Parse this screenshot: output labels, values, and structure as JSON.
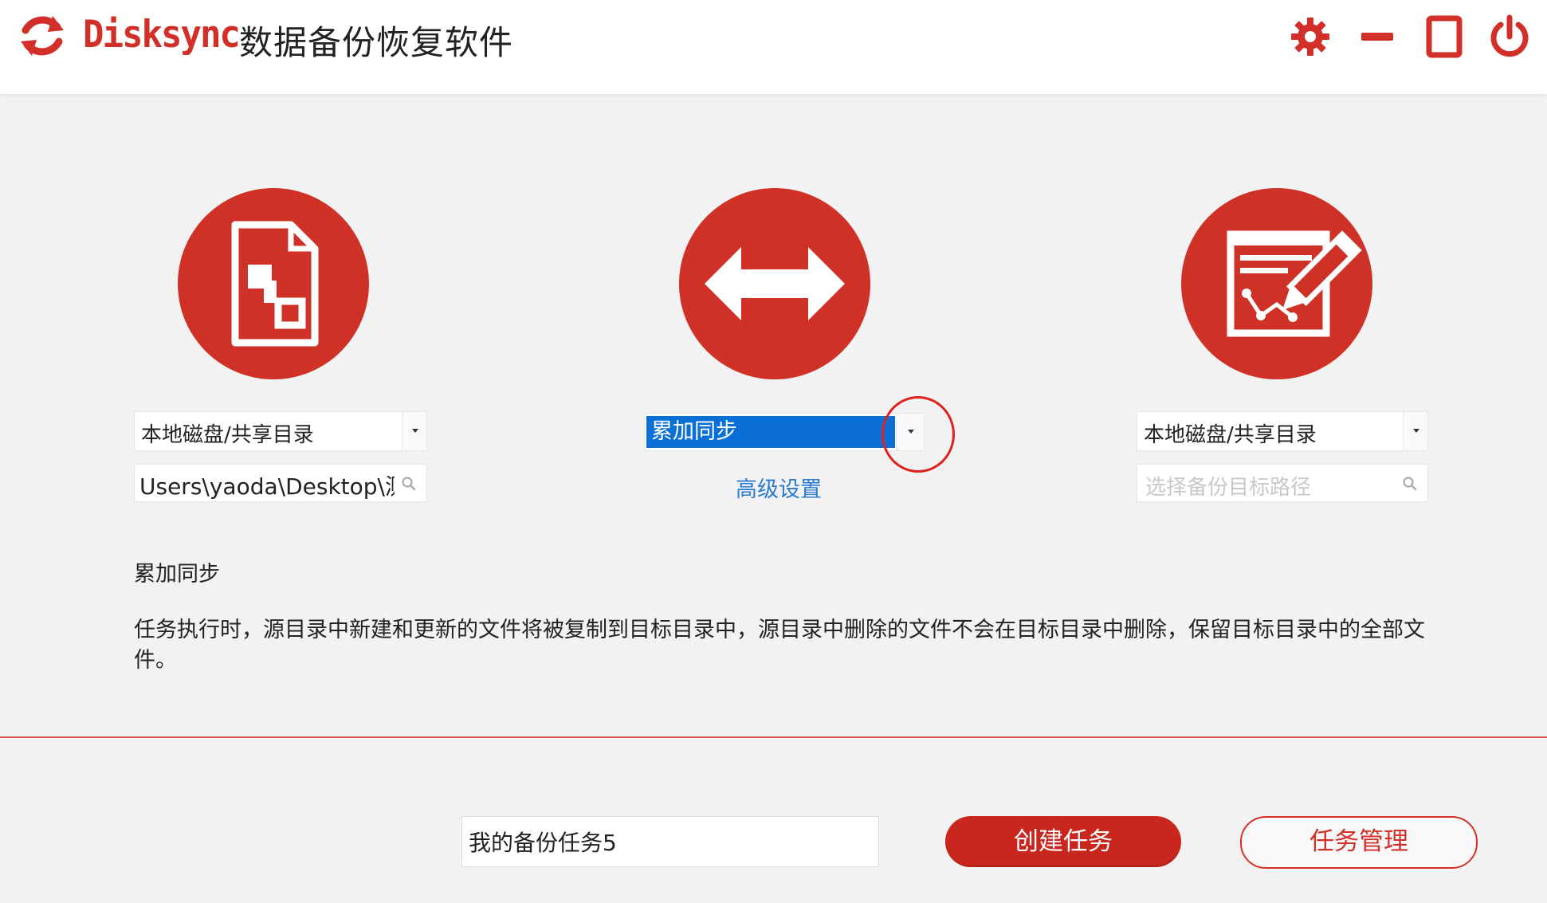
{
  "app": {
    "brand": "Disksync",
    "title": "数据备份恢复软件",
    "accent_color": "#cf3127"
  },
  "window_controls": {
    "settings_icon": "gear-icon",
    "minimize_icon": "minimize-icon",
    "maximize_icon": "maximize-icon",
    "power_icon": "power-icon"
  },
  "source": {
    "icon": "source-file-icon",
    "type_selected": "本地磁盘/共享目录",
    "path_value": "Users\\yaoda\\Desktop\\测"
  },
  "sync": {
    "icon": "bidirectional-arrow-icon",
    "mode_selected": "累加同步",
    "advanced_link": "高级设置"
  },
  "target": {
    "icon": "edit-document-icon",
    "type_selected": "本地磁盘/共享目录",
    "path_placeholder": "选择备份目标路径"
  },
  "description": {
    "mode_name": "累加同步",
    "text": "任务执行时，源目录中新建和更新的文件将被复制到目标目录中，源目录中删除的文件不会在目标目录中删除，保留目标目录中的全部文件。"
  },
  "footer": {
    "task_name_value": "我的备份任务5",
    "create_button": "创建任务",
    "manage_button": "任务管理"
  }
}
